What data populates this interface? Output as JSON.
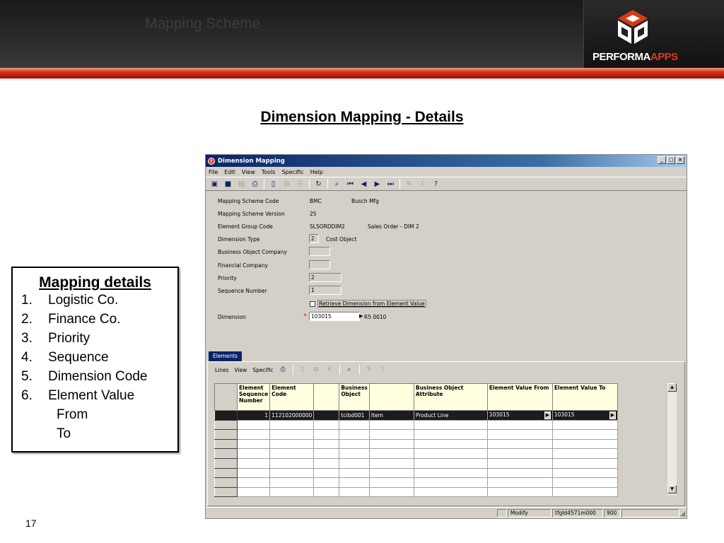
{
  "slide": {
    "header_title": "Mapping Scheme",
    "logo": {
      "brand": "PERFORMA",
      "accent": "APPS"
    },
    "title": "Dimension Mapping - Details",
    "page_number": "17",
    "mapping_box": {
      "heading": "Mapping details",
      "items": [
        {
          "num": "1.",
          "text": "Logistic Co."
        },
        {
          "num": "2.",
          "text": "Finance Co."
        },
        {
          "num": "3.",
          "text": "Priority"
        },
        {
          "num": "4.",
          "text": "Sequence"
        },
        {
          "num": "5.",
          "text": "Dimension Code"
        },
        {
          "num": "6.",
          "text": "Element Value"
        }
      ],
      "subitems": [
        "From",
        "To"
      ]
    }
  },
  "window": {
    "title": "Dimension Mapping",
    "controls": {
      "minimize": "_",
      "maximize": "□",
      "close": "×"
    },
    "menu": [
      "File",
      "Edit",
      "View",
      "Tools",
      "Specific",
      "Help"
    ],
    "form": {
      "mapping_scheme_code": {
        "label": "Mapping Scheme Code",
        "value": "BMC",
        "desc": "Busch Mfg"
      },
      "mapping_scheme_version": {
        "label": "Mapping Scheme Version",
        "value": "25"
      },
      "element_group_code": {
        "label": "Element Group Code",
        "value": "SLSORDDIM2",
        "desc": "Sales Order - DIM 2"
      },
      "dimension_type": {
        "label": "Dimension Type",
        "value": "2",
        "desc": "Cost Object"
      },
      "business_object_company": {
        "label": "Business Object Company",
        "value": ""
      },
      "financial_company": {
        "label": "Financial Company",
        "value": ""
      },
      "priority": {
        "label": "Priority",
        "value": "2"
      },
      "sequence_number": {
        "label": "Sequence Number",
        "value": "1"
      },
      "retrieve_checkbox": {
        "label": "Retrieve Dimension from Element Value"
      },
      "dimension": {
        "label": "Dimension",
        "required": "*",
        "value": "103015",
        "desc": "R5 0010"
      }
    },
    "tab": "Elements",
    "submenu": [
      "Lines",
      "View",
      "Specific"
    ],
    "grid": {
      "columns": [
        "Element Sequence Number",
        "Element Code",
        "",
        "Business Object",
        "",
        "Business Object Attribute",
        "Element Value From",
        "Element Value To"
      ],
      "rows": [
        {
          "seq": "1",
          "element_code": "112102000000",
          "blank1": "",
          "business_object": "tcibd001",
          "bo_desc": "Item",
          "attribute": "Product Line",
          "value_from": "103015",
          "value_to": "103015"
        }
      ]
    },
    "status": {
      "mode": "Modify",
      "session": "tfgld4571m000",
      "code": "900"
    }
  }
}
